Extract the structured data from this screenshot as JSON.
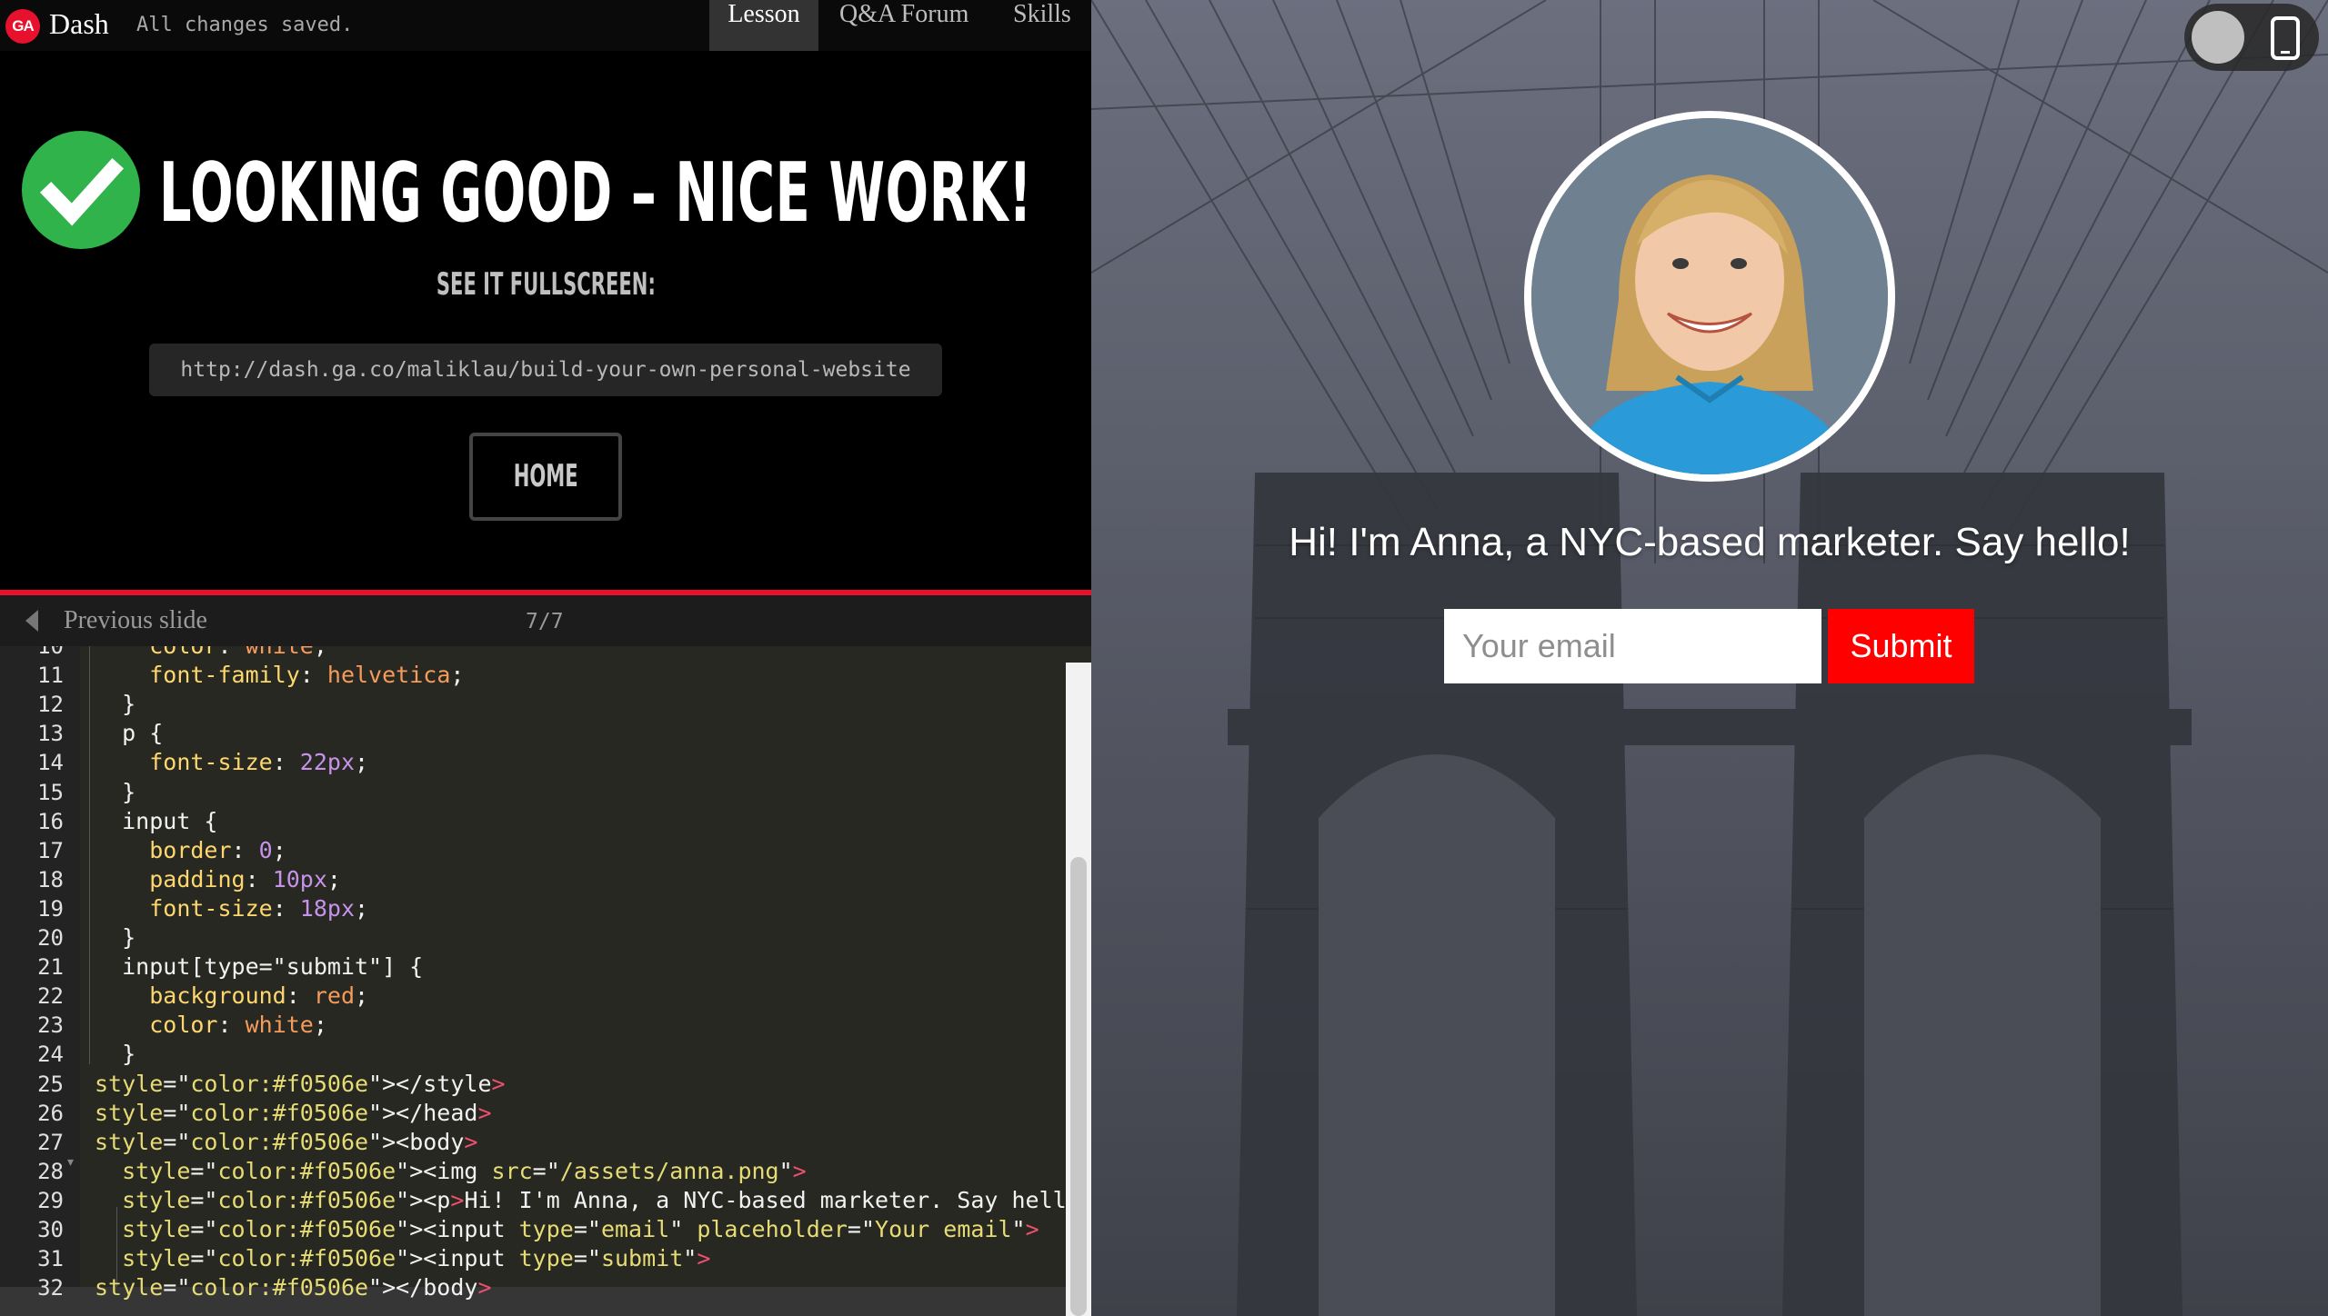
{
  "app": {
    "logo_text": "GA",
    "brand": "Dash",
    "save_status": "All changes saved.",
    "tabs": [
      {
        "label": "Lesson",
        "active": true
      },
      {
        "label": "Q&A Forum",
        "active": false
      },
      {
        "label": "Skills",
        "active": false
      }
    ]
  },
  "success": {
    "title": "LOOKING GOOD – NICE WORK!",
    "fullscreen_label": "SEE IT FULLSCREEN:",
    "url": "http://dash.ga.co/maliklau/build-your-own-personal-website",
    "home_label": "HOME"
  },
  "slides": {
    "prev_label": "Previous slide",
    "counter": "7/7"
  },
  "editor": {
    "lines": [
      {
        "n": "10",
        "text": "    color: white;"
      },
      {
        "n": "11",
        "text": "    font-family: helvetica;"
      },
      {
        "n": "12",
        "text": "  }"
      },
      {
        "n": "13",
        "text": "  p {"
      },
      {
        "n": "14",
        "text": "    font-size: 22px;"
      },
      {
        "n": "15",
        "text": "  }"
      },
      {
        "n": "16",
        "text": "  input {"
      },
      {
        "n": "17",
        "text": "    border: 0;"
      },
      {
        "n": "18",
        "text": "    padding: 10px;"
      },
      {
        "n": "19",
        "text": "    font-size: 18px;"
      },
      {
        "n": "20",
        "text": "  }"
      },
      {
        "n": "21",
        "text": "  input[type=\"submit\"] {"
      },
      {
        "n": "22",
        "text": "    background: red;"
      },
      {
        "n": "23",
        "text": "    color: white;"
      },
      {
        "n": "24",
        "text": "  }"
      },
      {
        "n": "25",
        "text": "</style>"
      },
      {
        "n": "26",
        "text": "</head>"
      },
      {
        "n": "27",
        "text": "<body>"
      },
      {
        "n": "28",
        "text": "  <img src=\"/assets/anna.png\">"
      },
      {
        "n": "29",
        "text": "  <p>Hi! I'm Anna, a NYC-based marketer. Say hello!</p>"
      },
      {
        "n": "30",
        "text": "  <input type=\"email\" placeholder=\"Your email\">"
      },
      {
        "n": "31",
        "text": "  <input type=\"submit\">"
      },
      {
        "n": "32",
        "text": "</body>"
      }
    ]
  },
  "preview": {
    "intro": "Hi! I'm Anna, a NYC-based marketer. Say hello!",
    "email_placeholder": "Your email",
    "submit_label": "Submit"
  },
  "colors": {
    "ga_red": "#e8112d",
    "success_green": "#2fb34a",
    "submit_red": "#ff0000",
    "code_property": "#fdd76e",
    "code_value": "#f69b5b",
    "code_number": "#c792ea",
    "code_tag": "#f0506e",
    "code_attr": "#e6db74"
  }
}
